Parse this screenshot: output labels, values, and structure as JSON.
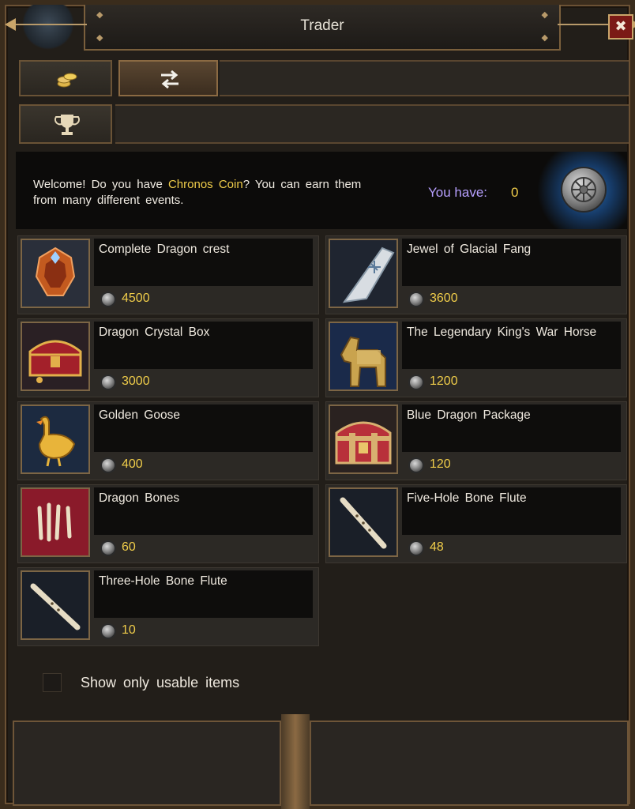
{
  "window": {
    "title": "Trader",
    "close_icon": "close-icon"
  },
  "tabs_top": [
    {
      "icon": "coins-icon",
      "active": false
    },
    {
      "icon": "exchange-icon",
      "active": true
    }
  ],
  "tabs_sub": [
    {
      "icon": "trophy-icon",
      "active": true
    }
  ],
  "banner": {
    "welcome_pre": "Welcome! Do you have ",
    "currency": "Chronos Coin",
    "welcome_post": "? You can earn them from many different events.",
    "have_label": "You have:",
    "have_value": "0",
    "coin_icon": "chronos-coin-icon"
  },
  "items": [
    {
      "name": "Complete Dragon crest",
      "price": "4500",
      "icon": "dragon-crest-icon"
    },
    {
      "name": "Jewel of Glacial Fang",
      "price": "3600",
      "icon": "glacial-fang-icon"
    },
    {
      "name": "Dragon Crystal Box",
      "price": "3000",
      "icon": "treasure-chest-icon"
    },
    {
      "name": "The Legendary King's War Horse",
      "price": "1200",
      "icon": "war-horse-icon"
    },
    {
      "name": "Golden Goose",
      "price": "400",
      "icon": "golden-goose-icon"
    },
    {
      "name": "Blue Dragon Package",
      "price": "120",
      "icon": "package-chest-icon"
    },
    {
      "name": "Dragon Bones",
      "price": "60",
      "icon": "bones-icon"
    },
    {
      "name": "Five-Hole Bone Flute",
      "price": "48",
      "icon": "flute-icon"
    },
    {
      "name": "Three-Hole Bone Flute",
      "price": "10",
      "icon": "flute-icon"
    }
  ],
  "filter": {
    "label": "Show only usable items",
    "checked": false
  },
  "colors": {
    "accent_gold": "#f0cd4a",
    "have_label": "#b7a0ff",
    "frame_bronze": "#7a5f3c",
    "close_red": "#7b1a16"
  }
}
